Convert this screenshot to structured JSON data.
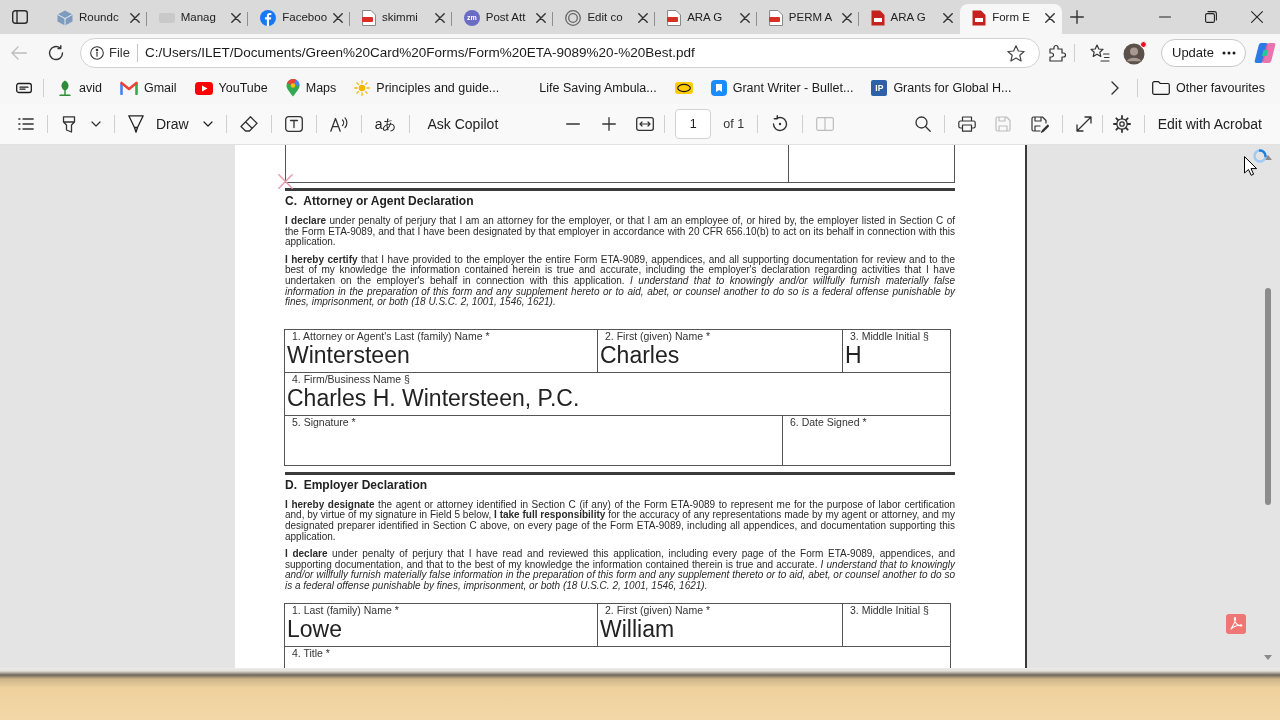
{
  "tabs": [
    {
      "title": "Roundc",
      "kind": "cube",
      "selected": false
    },
    {
      "title": "Manag",
      "kind": "blank",
      "selected": false
    },
    {
      "title": "Faceboo",
      "kind": "social",
      "selected": false
    },
    {
      "title": "skimmi",
      "kind": "pdf",
      "selected": false
    },
    {
      "title": "Post Att",
      "kind": "badge",
      "logo_text": "zm",
      "selected": false
    },
    {
      "title": "Edit co",
      "kind": "ring",
      "selected": false
    },
    {
      "title": "ARA G",
      "kind": "pdf",
      "selected": false
    },
    {
      "title": "PERM A",
      "kind": "pdf",
      "selected": false
    },
    {
      "title": "ARA G",
      "kind": "acrobat",
      "selected": false
    },
    {
      "title": "Form E",
      "kind": "acrobat",
      "selected": true
    }
  ],
  "toolbar": {
    "back_disabled": true,
    "scheme": "File",
    "url": "C:/Users/ILET/Documents/Green%20Card%20Forms/Form%20ETA-9089%20-%20Best.pdf",
    "update_button": "Update"
  },
  "bookmarks": {
    "items": [
      {
        "label": "avid",
        "kind": "leaf"
      },
      {
        "label": "Gmail",
        "kind": "mail"
      },
      {
        "label": "YouTube",
        "kind": "video"
      },
      {
        "label": "Maps",
        "kind": "pin"
      },
      {
        "label": "Principles and guide...",
        "kind": "sun"
      },
      {
        "label": "Life Saving Ambula...",
        "kind": "none"
      },
      {
        "kind": "oval"
      },
      {
        "label": "Grant Writer - Bullet...",
        "kind": "tile"
      },
      {
        "label": "Grants for Global H...",
        "kind": "badge",
        "logo_text": "IP"
      }
    ],
    "other": "Other favourites"
  },
  "pdf_toolbar": {
    "draw": "Draw",
    "translate": "aあ",
    "ask_copilot": "Ask Copilot",
    "page": "1",
    "page_count": "of 1",
    "page_view_disabled": true,
    "save_disabled": true,
    "edit_button": "Edit with Acrobat"
  },
  "document": {
    "sections": [
      {
        "heading": "C.  Attorney or Agent Declaration",
        "paragraphs": [
          "**I declare** under penalty of perjury that I am an attorney for the employer, or that I am an employee of, or hired by, the employer listed in Section C of the Form ETA-9089, and that I have been designated by that employer in accordance with 20 CFR 656.10(b) to act on its behalf in connection with this application.",
          "**I hereby certify** that I have provided to the employer the entire Form ETA-9089, appendices, and all supporting documentation for review and to the best of my knowledge the information contained herein is true and accurate, including the employer's declaration regarding activities that I have undertaken on the employer's behalf in connection with this application. *I understand that to knowingly and/or willfully furnish materially false information in the preparation of this form and any supplement hereto or to aid, abet, or counsel another to do so is a federal offense punishable by fines, imprisonment, or both (18 U.S.C. 2, 1001, 1546, 1621).*"
        ],
        "form_rows": [
          [
            {
              "label": "1. Attorney or Agent's Last (family) Name *",
              "value": "Wintersteen"
            },
            {
              "label": "2. First (given) Name *",
              "value": "Charles"
            },
            {
              "label": "3. Middle Initial §",
              "value": "H"
            }
          ],
          [
            {
              "label": "4. Firm/Business Name §",
              "value": "Charles H. Wintersteen, P.C."
            }
          ],
          [
            {
              "label": "5. Signature *"
            },
            {
              "label": "6. Date Signed *"
            }
          ]
        ]
      },
      {
        "heading": "D.  Employer Declaration",
        "paragraphs": [
          "**I hereby designate** the agent or attorney identified in Section C (if any) of the Form ETA-9089 to represent me for the purpose of labor certification and, by virtue of my signature in Field 5 below, **I take full responsibility** for the accuracy of any representations made by my agent or attorney, and my designated preparer identified in Section C above, on every page of the Form ETA-9089, including all appendices, and documentation supporting this application.",
          "**I declare** under penalty of perjury that I have read and reviewed this application, including every page of the Form ETA-9089, appendices, and supporting documentation, and that to the best of my knowledge the information contained therein is true and accurate. *I understand that to knowingly and/or willfully furnish materially false information in the preparation of this form and any supplement thereto or to aid, abet, or counsel another to do so is a federal offense punishable by fines, imprisonment, or both (18 U.S.C. 2, 1001, 1546, 1621).*"
        ],
        "form_rows": [
          [
            {
              "label": "1. Last (family) Name *",
              "value": "Lowe"
            },
            {
              "label": "2. First (given) Name *",
              "value": "William"
            },
            {
              "label": "3. Middle Initial §"
            }
          ],
          [
            {
              "label": "4. Title *"
            }
          ]
        ]
      }
    ]
  }
}
